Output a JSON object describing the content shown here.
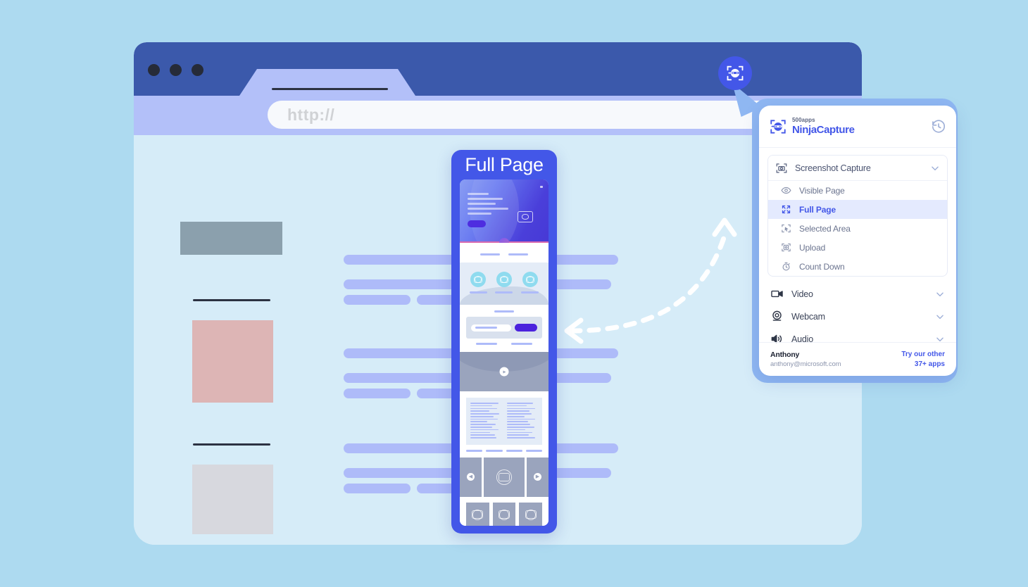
{
  "browser": {
    "url_placeholder": "http://",
    "window_dots": 3
  },
  "badge": {
    "icon": "ninja-capture-icon"
  },
  "phone": {
    "title": "Full Page"
  },
  "panel": {
    "logo": {
      "brand_sub": "500apps",
      "brand_name": "NinjaCapture",
      "icon": "ninja-logo-icon"
    },
    "history_icon": "history-icon",
    "capture_group": {
      "icon": "screenshot-capture-icon",
      "label": "Screenshot Capture",
      "chevron": "chevron-down-icon",
      "items": [
        {
          "label": "Visible Page",
          "icon": "eye-icon",
          "active": false
        },
        {
          "label": "Full Page",
          "icon": "expand-icon",
          "active": true
        },
        {
          "label": "Selected Area",
          "icon": "selection-cursor-icon",
          "active": false
        },
        {
          "label": "Upload",
          "icon": "upload-image-icon",
          "active": false
        },
        {
          "label": "Count Down",
          "icon": "stopwatch-icon",
          "active": false
        }
      ]
    },
    "sections": [
      {
        "label": "Video",
        "icon": "video-camera-icon",
        "chevron": "chevron-down-icon"
      },
      {
        "label": "Webcam",
        "icon": "webcam-icon",
        "chevron": "chevron-down-icon"
      },
      {
        "label": "Audio",
        "icon": "speaker-icon",
        "chevron": "chevron-down-icon"
      }
    ],
    "footer": {
      "user_name": "Anthony",
      "user_email": "anthony@microsoft.com",
      "try_line1": "Try our other",
      "try_line2": "37+ apps"
    }
  },
  "colors": {
    "page_background": "#addaf0",
    "browser_chrome": "#3b59ab",
    "browser_urlbar_strip": "#b3c0f9",
    "browser_content": "#d6ecf8",
    "accent_blue": "#4357e8",
    "active_item_bg": "#e4eafe",
    "text_bar": "#aebbf9",
    "block_gray": "#8ba0ad",
    "block_pink": "#ddb5b5",
    "block_light_gray": "#d7d8de"
  }
}
